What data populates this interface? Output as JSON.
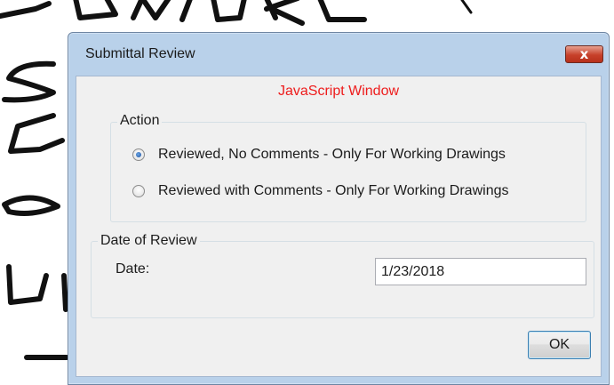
{
  "dialog": {
    "title": "Submittal Review",
    "close_label": "x",
    "heading": "JavaScript Window",
    "colors": {
      "heading": "#ee1c1c",
      "frame": "#b9d1ea",
      "close": "#c7402a"
    }
  },
  "action_group": {
    "legend": "Action",
    "options": [
      {
        "label": "Reviewed, No Comments - Only For Working Drawings",
        "checked": true
      },
      {
        "label": "Reviewed with Comments - Only For Working Drawings",
        "checked": false
      }
    ]
  },
  "date_group": {
    "legend": "Date of Review",
    "date_label": "Date:",
    "date_value": "1/23/2018"
  },
  "buttons": {
    "ok_label": "OK"
  }
}
